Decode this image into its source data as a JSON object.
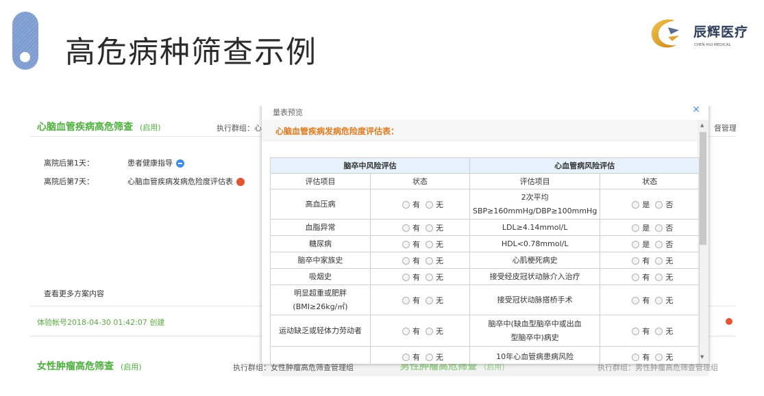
{
  "slide": {
    "title": "高危病种筛查示例"
  },
  "logo": {
    "cn": "辰辉医疗",
    "en": "CHEN HUI MEDICAL"
  },
  "background": {
    "panel1": {
      "title": "心脑血管疾病高危筛查",
      "status": "(启用)",
      "exec_group": "执行群组：心"
    },
    "rows": [
      {
        "day": "离院后第1天：",
        "item": "患者健康指导"
      },
      {
        "day": "离院后第7天：",
        "item": "心脑血管疾病发病危险度评估表"
      }
    ],
    "more": "查看更多方案内容",
    "created": "体验帐号2018-04-30 01:42:07 创建",
    "right_exec": "督管理组",
    "panel2": {
      "title": "女性肿瘤高危筛查",
      "status": "(启用)",
      "exec_group": "执行群组：女性肿瘤高危筛查管理组"
    },
    "panel3": {
      "title": "男性肿瘤高危筛查",
      "status": "(启用)",
      "exec_group": "执行群组：男性肿瘤高危筛查管理组"
    }
  },
  "modal": {
    "header": "量表预览",
    "close": "×",
    "form_title": "心脑血管疾病发病危险度评估表：",
    "group_left": "脑卒中风险评估",
    "group_right": "心血管病风险评估",
    "col_item": "评估项目",
    "col_status": "状态",
    "rows": [
      {
        "left": "高血压病",
        "left_opts": [
          "有",
          "无"
        ],
        "right": [
          "2次平均",
          "SBP≥160mmHg/DBP≥100mmHg"
        ],
        "right_opts": [
          "是",
          "否"
        ]
      },
      {
        "left": "血脂异常",
        "left_opts": [
          "有",
          "无"
        ],
        "right": [
          "LDL≥4.14mmol/L"
        ],
        "right_opts": [
          "是",
          "否"
        ]
      },
      {
        "left": "糖尿病",
        "left_opts": [
          "有",
          "无"
        ],
        "right": [
          "HDL<0.78mmol/L"
        ],
        "right_opts": [
          "是",
          "否"
        ]
      },
      {
        "left": "脑卒中家族史",
        "left_opts": [
          "有",
          "无"
        ],
        "right": [
          "心肌梗死病史"
        ],
        "right_opts": [
          "有",
          "无"
        ]
      },
      {
        "left": "吸烟史",
        "left_opts": [
          "有",
          "无"
        ],
        "right": [
          "接受经皮冠状动脉介入治疗"
        ],
        "right_opts": [
          "有",
          "无"
        ]
      },
      {
        "left": "明显超重或肥胖\n(BMI≥26kg/㎡)",
        "left_opts": [
          "有",
          "无"
        ],
        "right": [
          "接受冠状动脉搭桥手术"
        ],
        "right_opts": [
          "有",
          "无"
        ]
      },
      {
        "left": "运动缺乏或轻体力劳动者",
        "left_opts": [
          "有",
          "无"
        ],
        "right": [
          "脑卒中(缺血型脑卒中或出血",
          "型脑卒中)病史"
        ],
        "right_opts": [
          "有",
          "无"
        ]
      },
      {
        "left": "",
        "left_opts": [
          "有",
          "无"
        ],
        "right": [
          "10年心血管病患病风险"
        ],
        "right_opts": [
          "有",
          "无"
        ]
      }
    ]
  }
}
